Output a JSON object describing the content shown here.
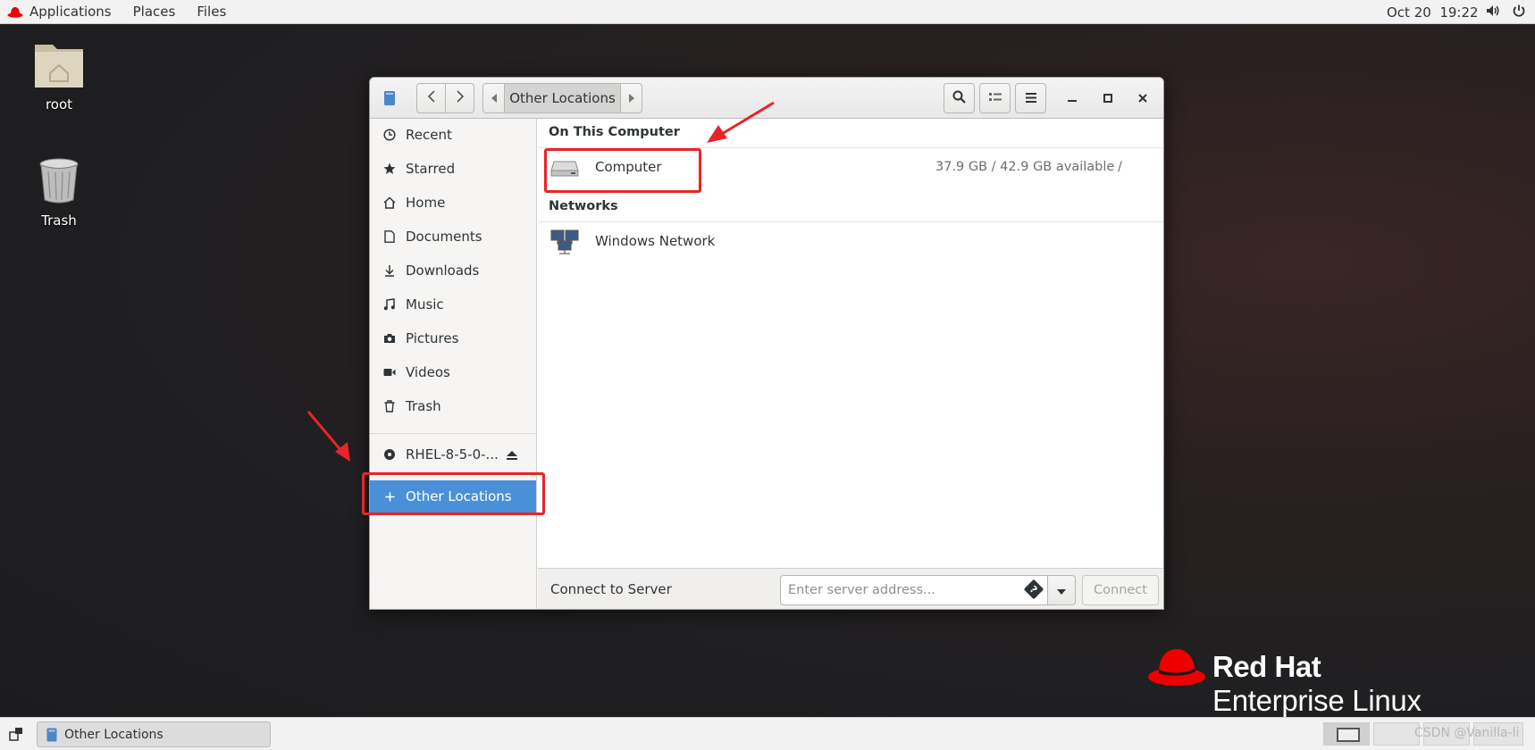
{
  "topbar": {
    "menu": [
      "Applications",
      "Places",
      "Files"
    ],
    "clock": "Oct 20  19:22"
  },
  "desktop": {
    "icons": [
      {
        "label": "root",
        "icon": "home-folder-icon"
      },
      {
        "label": "Trash",
        "icon": "trash-icon"
      }
    ]
  },
  "window": {
    "path_label": "Other Locations",
    "sidebar": {
      "items": [
        {
          "label": "Recent",
          "icon": "clock-icon"
        },
        {
          "label": "Starred",
          "icon": "star-icon"
        },
        {
          "label": "Home",
          "icon": "home-icon"
        },
        {
          "label": "Documents",
          "icon": "document-icon"
        },
        {
          "label": "Downloads",
          "icon": "download-icon"
        },
        {
          "label": "Music",
          "icon": "music-icon"
        },
        {
          "label": "Pictures",
          "icon": "camera-icon"
        },
        {
          "label": "Videos",
          "icon": "video-icon"
        },
        {
          "label": "Trash",
          "icon": "trash-icon"
        }
      ],
      "device": {
        "label": "RHEL-8-5-0-...",
        "icon": "disc-icon"
      },
      "other_locations": {
        "label": "Other Locations",
        "icon": "plus-icon"
      }
    },
    "content": {
      "on_this_computer": "On This Computer",
      "computer": {
        "name": "Computer",
        "available": "37.9 GB / 42.9 GB available",
        "mount": "/"
      },
      "networks": "Networks",
      "windows_network": {
        "name": "Windows Network"
      }
    },
    "connect": {
      "label": "Connect to Server",
      "placeholder": "Enter server address...",
      "help_glyph": "?",
      "button": "Connect"
    }
  },
  "logo": {
    "line1": "Red Hat",
    "line2": "Enterprise Linux"
  },
  "taskbar": {
    "window_label": "Other Locations"
  },
  "watermark": "CSDN @Vanilla-li",
  "colors": {
    "selection": "#4a90d9",
    "annotation_red": "#e8242a",
    "redhat_red": "#ee0000"
  }
}
